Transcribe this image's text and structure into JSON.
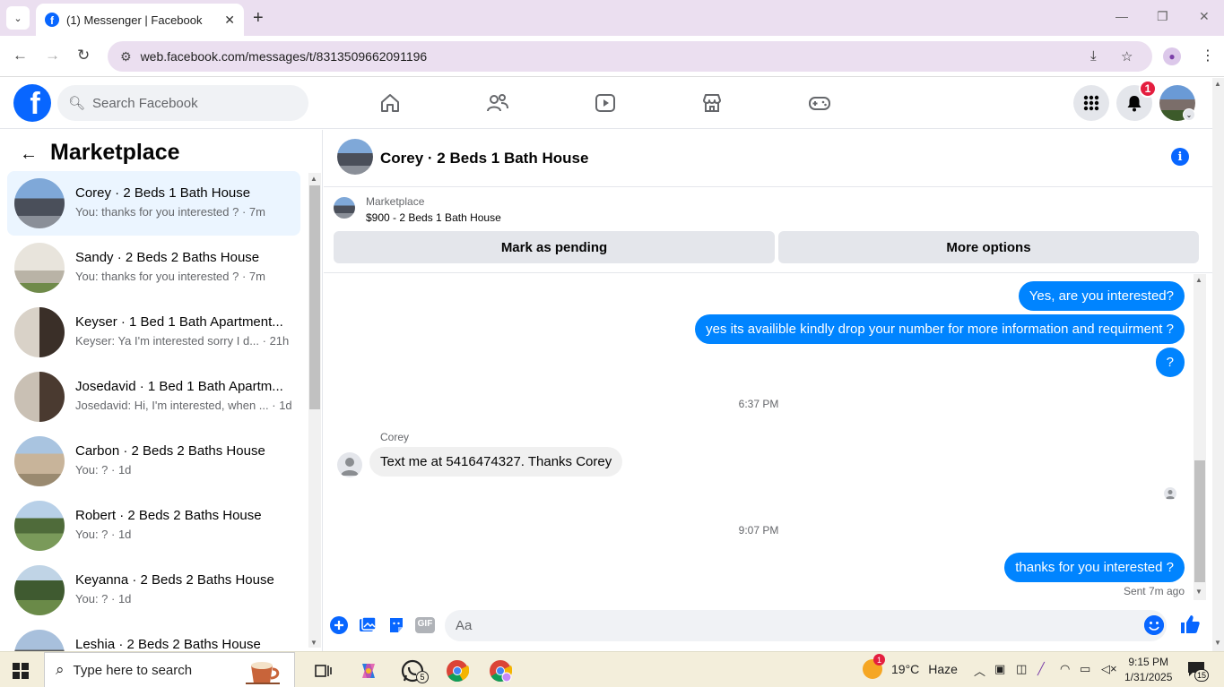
{
  "browser": {
    "tab_title": "(1) Messenger | Facebook",
    "tab_close": "✕",
    "new_tab": "+",
    "url": "web.facebook.com/messages/t/8313509662091196",
    "window_controls": [
      "—",
      "❐",
      "✕"
    ]
  },
  "header": {
    "search_placeholder": "Search Facebook",
    "nav_icons": [
      "home-icon",
      "friends-icon",
      "video-icon",
      "marketplace-icon",
      "gaming-icon"
    ],
    "notification_count": "1"
  },
  "sidebar": {
    "title": "Marketplace",
    "conversations": [
      {
        "name": "Corey · 2 Beds 1 Bath House",
        "snippet": "You: thanks for you interested ? · 7m"
      },
      {
        "name": "Sandy · 2 Beds 2 Baths House",
        "snippet": "You: thanks for you interested ? · 7m"
      },
      {
        "name": "Keyser · 1 Bed 1 Bath Apartment...",
        "snippet": "Keyser: Ya I'm interested sorry I d... · 21h"
      },
      {
        "name": "Josedavid · 1 Bed 1 Bath Apartm...",
        "snippet": "Josedavid: Hi, I'm interested, when ... · 1d"
      },
      {
        "name": "Carbon · 2 Beds 2 Baths House",
        "snippet": "You: ? · 1d"
      },
      {
        "name": "Robert · 2 Beds 2 Baths House",
        "snippet": "You: ? · 1d"
      },
      {
        "name": "Keyanna · 2 Beds 2 Baths House",
        "snippet": "You: ? · 1d"
      },
      {
        "name": "Leshia · 2 Beds 2 Baths House",
        "snippet": ""
      }
    ]
  },
  "chat": {
    "title": "Corey · 2 Beds 1 Bath House",
    "marketplace_label": "Marketplace",
    "listing": "$900 - 2 Beds 1 Bath House",
    "btn_pending": "Mark as pending",
    "btn_more": "More options",
    "messages": {
      "out1": "Yes, are you interested?",
      "out2": "yes its availible kindly drop your number for more information and requirment ?",
      "out3": "?",
      "time1": "6:37 PM",
      "sender": "Corey",
      "in1": "Text me at 5416474327. Thanks Corey",
      "time2": "9:07 PM",
      "out4": "thanks for you interested ?",
      "sent_status": "Sent 7m ago"
    },
    "composer_placeholder": "Aa",
    "gif_label": "GIF"
  },
  "taskbar": {
    "search_placeholder": "Type here to search",
    "whatsapp_badge": "5",
    "weather_badge": "1",
    "temperature": "19°C",
    "condition": "Haze",
    "time": "9:15 PM",
    "date": "1/31/2025",
    "notification_count": "15"
  },
  "colors": {
    "messenger_blue": "#0084ff",
    "facebook_blue": "#0866ff",
    "notification_red": "#e41e3f"
  }
}
